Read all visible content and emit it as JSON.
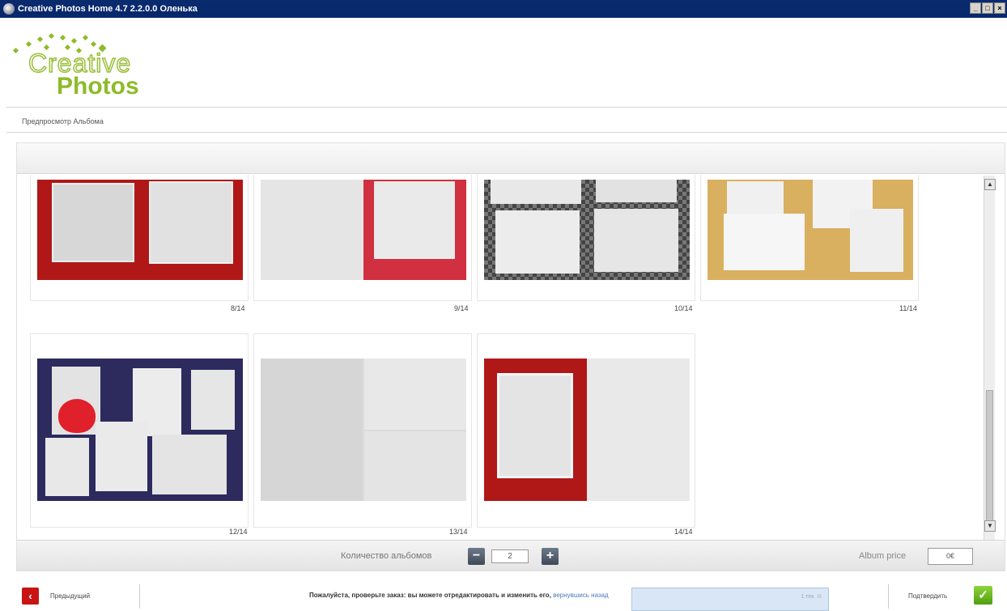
{
  "window": {
    "title": "Creative Photos Home 4.7 2.2.0.0 Оленька",
    "buttons": [
      "_",
      "□",
      "×"
    ]
  },
  "logo": {
    "line1": "Creative",
    "line2": "Photos",
    "color": "#8dbb2a"
  },
  "breadcrumb": "Предпросмотр Альбома",
  "pages": [
    {
      "label": "8/14",
      "bg": "#b01818"
    },
    {
      "label": "9/14",
      "bg": "#e5e5e5"
    },
    {
      "label": "10/14",
      "bg": "#555555"
    },
    {
      "label": "11/14",
      "bg": "#d9b060"
    },
    {
      "label": "12/14",
      "bg": "#2d2a5e"
    },
    {
      "label": "13/14",
      "bg": "#dcdcdc"
    },
    {
      "label": "14/14",
      "bg": "#b01818"
    }
  ],
  "bottom_bar": {
    "qty_label": "Количество альбомов",
    "minus": "−",
    "plus": "+",
    "qty_value": "2",
    "price_label": "Album price",
    "price_value": "0€"
  },
  "footer": {
    "prev_label": "Предыдущий",
    "message": "Пожалуйста, проверьте заказ: вы можете отредактировать и изменить его,",
    "message_link": "вернувшись назад",
    "tooltip_text": "1 тек. ⊙",
    "confirm_label": "Подтвердить",
    "prev_icon": "‹",
    "confirm_icon": "✓"
  },
  "scroll": {
    "up": "▲",
    "down": "▼"
  }
}
